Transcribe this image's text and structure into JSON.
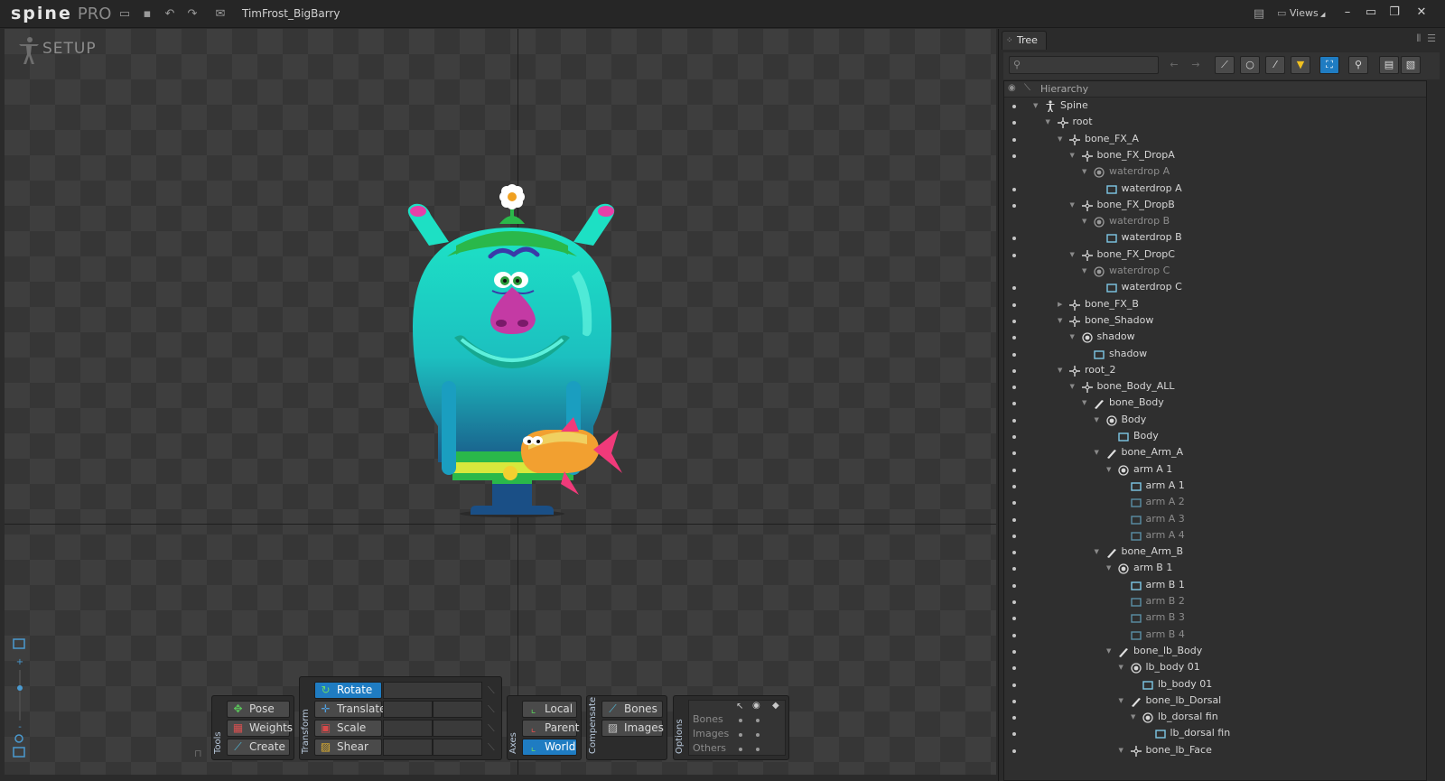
{
  "app": {
    "logo": "spine",
    "edition": "PRO",
    "document_title": "TimFrost_BigBarry",
    "views_label": "Views"
  },
  "titlebar_icons": [
    "folder-open-icon",
    "save-icon",
    "undo-icon",
    "redo-icon",
    "export-icon"
  ],
  "viewport": {
    "mode_label": "SETUP"
  },
  "toolbar": {
    "tools": {
      "label": "Tools",
      "items": [
        "Pose",
        "Weights",
        "Create"
      ]
    },
    "transform": {
      "label": "Transform",
      "items": [
        "Rotate",
        "Translate",
        "Scale",
        "Shear"
      ],
      "active": "Rotate"
    },
    "axes": {
      "label": "Axes",
      "items": [
        "Local",
        "Parent",
        "World"
      ],
      "active": "World"
    },
    "compensate": {
      "label": "Compensate",
      "items": [
        "Bones",
        "Images"
      ]
    },
    "options": {
      "label": "Options",
      "rows": [
        "Bones",
        "Images",
        "Others"
      ]
    }
  },
  "tree_panel": {
    "tab_label": "Tree",
    "search": {
      "value": "",
      "placeholder": ""
    },
    "header_label": "Hierarchy",
    "rows": [
      {
        "label": "Spine",
        "type": "skeleton",
        "depth": 0,
        "expanded": true,
        "visible": true
      },
      {
        "label": "root",
        "type": "bone",
        "depth": 1,
        "expanded": true,
        "visible": true
      },
      {
        "label": "bone_FX_A",
        "type": "bone",
        "depth": 2,
        "expanded": true,
        "visible": true
      },
      {
        "label": "bone_FX_DropA",
        "type": "bone",
        "depth": 3,
        "expanded": true,
        "visible": true
      },
      {
        "label": "waterdrop A",
        "type": "slot",
        "depth": 4,
        "expanded": true,
        "visible": false,
        "dim": true
      },
      {
        "label": "waterdrop A",
        "type": "image",
        "depth": 5,
        "visible": true
      },
      {
        "label": "bone_FX_DropB",
        "type": "bone",
        "depth": 3,
        "expanded": true,
        "visible": true
      },
      {
        "label": "waterdrop B",
        "type": "slot",
        "depth": 4,
        "expanded": true,
        "visible": false,
        "dim": true
      },
      {
        "label": "waterdrop B",
        "type": "image",
        "depth": 5,
        "visible": true
      },
      {
        "label": "bone_FX_DropC",
        "type": "bone",
        "depth": 3,
        "expanded": true,
        "visible": true
      },
      {
        "label": "waterdrop C",
        "type": "slot",
        "depth": 4,
        "expanded": true,
        "visible": false,
        "dim": true
      },
      {
        "label": "waterdrop C",
        "type": "image",
        "depth": 5,
        "visible": true
      },
      {
        "label": "bone_FX_B",
        "type": "bone",
        "depth": 2,
        "expanded": false,
        "visible": true
      },
      {
        "label": "bone_Shadow",
        "type": "bone",
        "depth": 2,
        "expanded": true,
        "visible": true
      },
      {
        "label": "shadow",
        "type": "slot",
        "depth": 3,
        "expanded": true,
        "visible": true
      },
      {
        "label": "shadow",
        "type": "image",
        "depth": 4,
        "visible": true
      },
      {
        "label": "root_2",
        "type": "bone",
        "depth": 2,
        "expanded": true,
        "visible": true
      },
      {
        "label": "bone_Body_ALL",
        "type": "bone",
        "depth": 3,
        "expanded": true,
        "visible": true
      },
      {
        "label": "bone_Body",
        "type": "bone-brush",
        "depth": 4,
        "expanded": true,
        "visible": true
      },
      {
        "label": "Body",
        "type": "slot",
        "depth": 5,
        "expanded": true,
        "visible": true
      },
      {
        "label": "Body",
        "type": "image",
        "depth": 6,
        "visible": true
      },
      {
        "label": "bone_Arm_A",
        "type": "bone-brush",
        "depth": 5,
        "expanded": true,
        "visible": true
      },
      {
        "label": "arm A 1",
        "type": "slot",
        "depth": 6,
        "expanded": true,
        "visible": true
      },
      {
        "label": "arm A 1",
        "type": "image",
        "depth": 7,
        "visible": true
      },
      {
        "label": "arm A 2",
        "type": "image",
        "depth": 7,
        "visible": true,
        "dim": true
      },
      {
        "label": "arm A 3",
        "type": "image",
        "depth": 7,
        "visible": true,
        "dim": true
      },
      {
        "label": "arm A 4",
        "type": "image",
        "depth": 7,
        "visible": true,
        "dim": true
      },
      {
        "label": "bone_Arm_B",
        "type": "bone-brush",
        "depth": 5,
        "expanded": true,
        "visible": true
      },
      {
        "label": "arm B 1",
        "type": "slot",
        "depth": 6,
        "expanded": true,
        "visible": true
      },
      {
        "label": "arm B 1",
        "type": "image",
        "depth": 7,
        "visible": true
      },
      {
        "label": "arm B 2",
        "type": "image",
        "depth": 7,
        "visible": true,
        "dim": true
      },
      {
        "label": "arm B 3",
        "type": "image",
        "depth": 7,
        "visible": true,
        "dim": true
      },
      {
        "label": "arm B 4",
        "type": "image",
        "depth": 7,
        "visible": true,
        "dim": true
      },
      {
        "label": "bone_lb_Body",
        "type": "bone-brush",
        "depth": 6,
        "expanded": true,
        "visible": true
      },
      {
        "label": "lb_body 01",
        "type": "slot",
        "depth": 7,
        "expanded": true,
        "visible": true
      },
      {
        "label": "lb_body 01",
        "type": "image",
        "depth": 8,
        "visible": true
      },
      {
        "label": "bone_lb_Dorsal",
        "type": "bone-brush",
        "depth": 7,
        "expanded": true,
        "visible": true
      },
      {
        "label": "lb_dorsal fin",
        "type": "slot",
        "depth": 8,
        "expanded": true,
        "visible": true
      },
      {
        "label": "lb_dorsal fin",
        "type": "image",
        "depth": 9,
        "visible": true
      },
      {
        "label": "bone_lb_Face",
        "type": "bone",
        "depth": 7,
        "expanded": true,
        "visible": true
      }
    ]
  },
  "colors": {
    "accent": "#1f7cc2",
    "panel_bg": "#2b2b2b",
    "image_icon": "#7ec7e6"
  }
}
